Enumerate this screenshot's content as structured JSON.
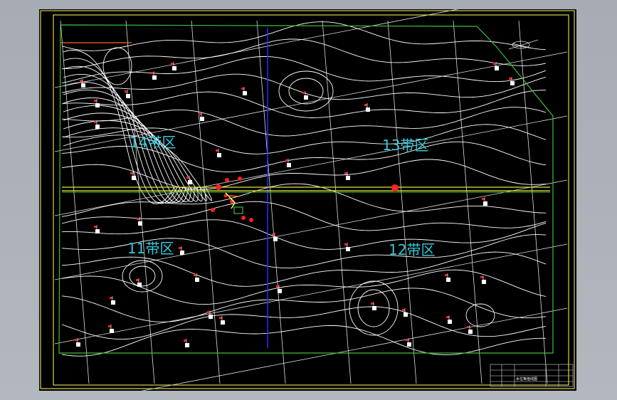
{
  "colors": {
    "background": "#000000",
    "frame": "#ffff66",
    "boundary": "#3cbf3c",
    "contour": "#ffffff",
    "divider": "#2a2aff",
    "road": "#e8e83a",
    "zone_text": "#37c6d8",
    "marker": "#ff2020"
  },
  "zones": [
    {
      "id": "zone-14",
      "label": "14带区"
    },
    {
      "id": "zone-13",
      "label": "13带区"
    },
    {
      "id": "zone-11",
      "label": "11带区"
    },
    {
      "id": "zone-12",
      "label": "12带区"
    }
  ],
  "icons": [
    "north-arrow-icon"
  ],
  "title_block": {
    "drawing_name": "水位等值线图"
  }
}
